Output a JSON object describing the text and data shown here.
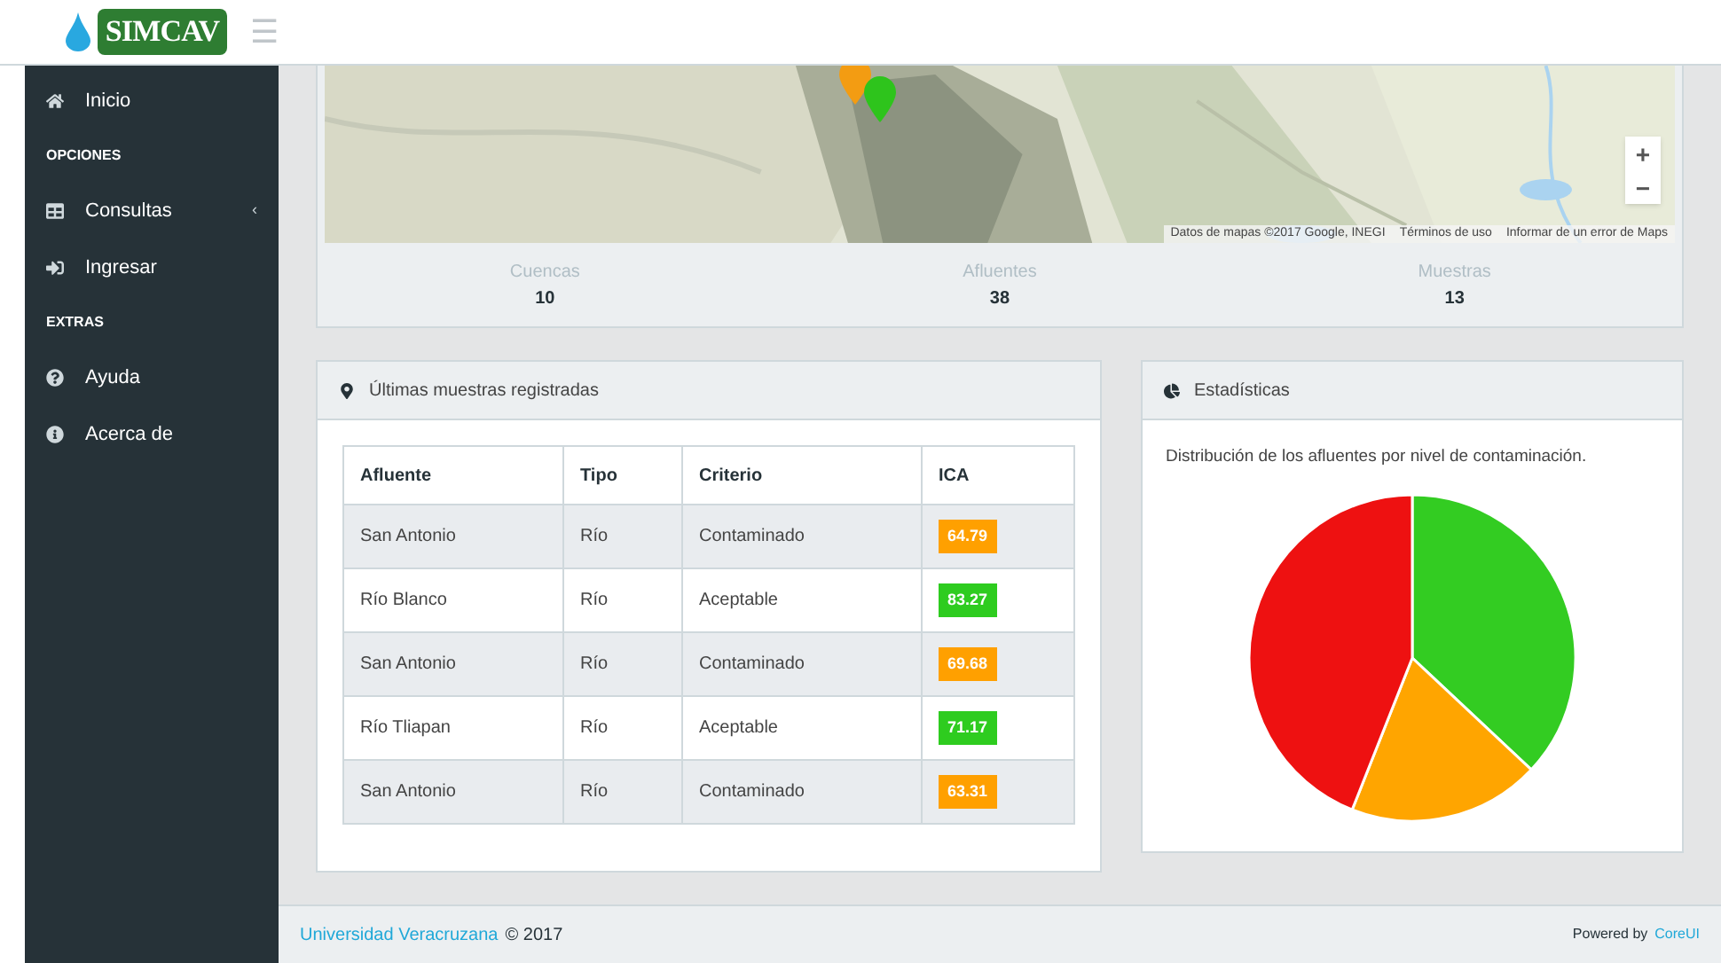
{
  "header": {
    "logo": "SIMCAV",
    "menu_toggle": "☰"
  },
  "sidebar": {
    "items": [
      {
        "kind": "link",
        "label": "Inicio",
        "selected": false
      },
      {
        "kind": "heading",
        "label": "OPCIONES"
      },
      {
        "kind": "link",
        "label": "Consultas",
        "caret": "‹",
        "selected": false
      },
      {
        "kind": "link",
        "label": "Ingresar",
        "selected": false
      },
      {
        "kind": "heading",
        "label": "EXTRAS"
      },
      {
        "kind": "link",
        "label": "Ayuda",
        "selected": false
      },
      {
        "kind": "link",
        "label": "Acerca de",
        "selected": false
      }
    ]
  },
  "map": {
    "markers": [
      {
        "color": "#f39c12"
      },
      {
        "color": "#2ec41c"
      }
    ],
    "zoom_buttons": [
      "+",
      "−"
    ],
    "attribution": [
      "Datos de mapas ©2017 Google, INEGI",
      "Términos de uso",
      "Informar de un error de Maps"
    ]
  },
  "stats": [
    {
      "label": "Cuencas",
      "value": "10"
    },
    {
      "label": "Afluentes",
      "value": "38"
    },
    {
      "label": "Muestras",
      "value": "13"
    }
  ],
  "samples_card": {
    "title": "Últimas muestras registradas",
    "table": {
      "columns": [
        "Afluente",
        "Tipo",
        "Criterio",
        "ICA"
      ],
      "rows": [
        {
          "cells": [
            "San Antonio",
            "Río",
            "Contaminado"
          ],
          "ica": "64.79",
          "color": "#ffa000"
        },
        {
          "cells": [
            "Río Blanco",
            "Río",
            "Aceptable"
          ],
          "ica": "83.27",
          "color": "#2ecc1f"
        },
        {
          "cells": [
            "San Antonio",
            "Río",
            "Contaminado"
          ],
          "ica": "69.68",
          "color": "#ffa000"
        },
        {
          "cells": [
            "Río Tliapan",
            "Río",
            "Aceptable"
          ],
          "ica": "71.17",
          "color": "#2ecc1f"
        },
        {
          "cells": [
            "San Antonio",
            "Río",
            "Contaminado"
          ],
          "ica": "63.31",
          "color": "#ffa000"
        }
      ]
    }
  },
  "stats_card": {
    "title": "Estadísticas",
    "description": "Distribución de los afluentes por nivel de contaminación."
  },
  "footer": {
    "link": "Universidad Veracruzana",
    "copyright": "© 2017",
    "powered": "Powered by",
    "powered_link": "CoreUI"
  }
}
